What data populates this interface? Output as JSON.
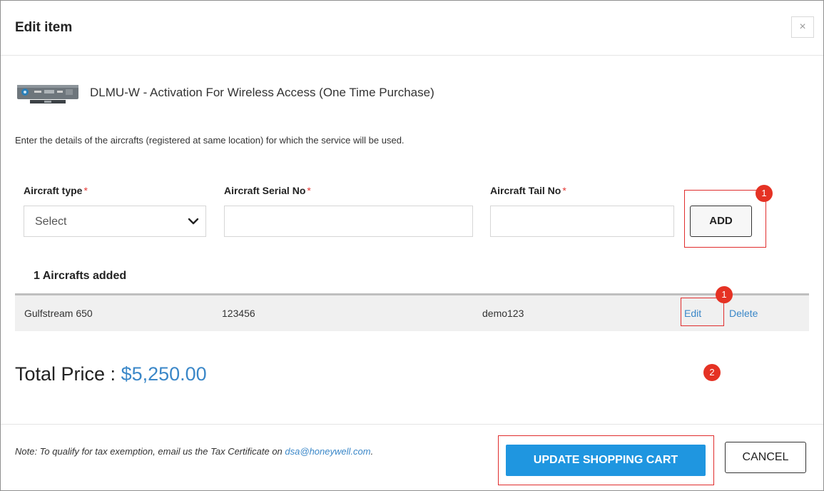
{
  "modal": {
    "title": "Edit item",
    "close_label": "×"
  },
  "product": {
    "name": "DLMU-W - Activation For Wireless Access (One Time Purchase)"
  },
  "instructions": "Enter the details of the aircrafts (registered at same location) for which the service will be used.",
  "form": {
    "aircraft_type_label": "Aircraft type",
    "aircraft_type_value": "Select",
    "serial_label": "Aircraft Serial No",
    "tail_label": "Aircraft Tail No",
    "required_mark": "*",
    "add_label": "ADD"
  },
  "aircrafts": {
    "count_label": "1 Aircrafts added",
    "rows": [
      {
        "type": "Gulfstream 650",
        "serial": "123456",
        "tail": "demo123",
        "edit_label": "Edit",
        "delete_label": "Delete"
      }
    ]
  },
  "total": {
    "label": "Total Price : ",
    "value": "$5,250.00"
  },
  "footer": {
    "note": "Note: To qualify for tax exemption, email us the Tax Certificate on ",
    "email": "dsa@honeywell.com",
    "note_end": ".",
    "update_label": "UPDATE SHOPPING CART",
    "cancel_label": "CANCEL"
  },
  "annotations": {
    "badge_add": "1",
    "badge_edit": "1",
    "badge_update": "2"
  },
  "colors": {
    "accent": "#1f96e0",
    "link": "#3a87c8",
    "highlight": "#e02d2d",
    "badge": "#e53224"
  }
}
